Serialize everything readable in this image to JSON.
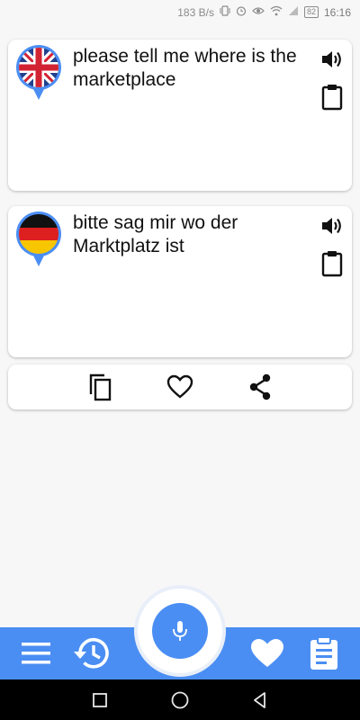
{
  "status_bar": {
    "network_speed": "183 B/s",
    "battery_level": "82",
    "time": "16:16",
    "icons": [
      "vibrate-icon",
      "alarm-icon",
      "eye-icon",
      "wifi-icon",
      "signal-icon",
      "battery-icon"
    ]
  },
  "source_card": {
    "flag": "uk-flag-icon",
    "text": "please tell me where is the marketplace",
    "speak_icon": "speaker-icon",
    "paste_icon": "clipboard-icon"
  },
  "target_card": {
    "flag": "germany-flag-icon",
    "text": "bitte sag mir wo der Marktplatz ist",
    "speak_icon": "speaker-icon",
    "paste_icon": "clipboard-icon"
  },
  "actions": {
    "icons": [
      "copy-icon",
      "heart-outline-icon",
      "share-icon"
    ]
  },
  "bottom_nav": {
    "icons": [
      "menu-icon",
      "history-icon",
      "microphone-icon",
      "heart-icon",
      "notes-icon"
    ]
  },
  "system_nav": {
    "icons": [
      "recents-icon",
      "home-icon",
      "back-icon"
    ]
  },
  "colors": {
    "accent": "#4b8ef3",
    "background": "#f7f7f7",
    "card": "#ffffff",
    "text": "#111111"
  }
}
